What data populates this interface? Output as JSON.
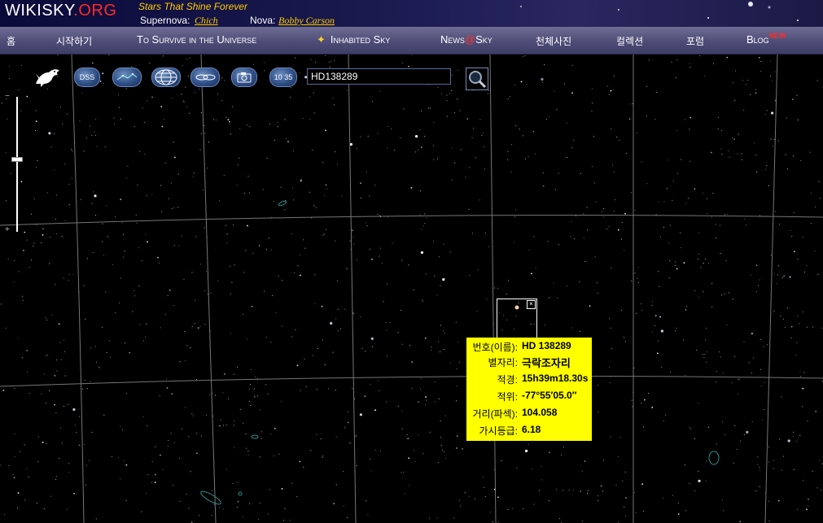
{
  "header": {
    "logo_main": "WIKISKY",
    "logo_suffix": ".ORG",
    "slogan": "Stars That Shine Forever",
    "supernova_label": "Supernova:",
    "supernova_link": "Chich",
    "nova_label": "Nova:",
    "nova_link": "Bobby Carson"
  },
  "nav": {
    "home": "홈",
    "start": "시작하기",
    "survive": "To Survive in the Universe",
    "inhabited": "Inhabited Sky",
    "news_pre": "News",
    "news_at": "@",
    "news_post": "Sky",
    "photos": "천체사진",
    "collection": "컬렉션",
    "forum": "포럼",
    "blog": "Blog",
    "blog_badge": "NEW"
  },
  "toolbar": {
    "dss_label": "DSS",
    "time_label": "10 35",
    "search_value": "HD138289",
    "icons": [
      "dragon-icon",
      "constellation-icon",
      "grid-globe-icon",
      "galaxy-icon",
      "camera-icon",
      "search-icon"
    ]
  },
  "info": {
    "name_label": "번호(이름):",
    "name_value": "HD 138289",
    "constellation_label": "별자리:",
    "constellation_value": "극락조자리",
    "ra_label": "적경:",
    "ra_value": "15h39m18.30s",
    "dec_label": "적위:",
    "dec_value": "-77°55′05.0″",
    "distance_label": "거리(파섹):",
    "distance_value": "104.058",
    "magnitude_label": "가시등급:",
    "magnitude_value": "6.18"
  },
  "colors": {
    "accent_red": "#ff2a2a",
    "link_yellow": "#ffcc00",
    "info_bg": "#ffff00",
    "nav_bg": "#54537d"
  }
}
